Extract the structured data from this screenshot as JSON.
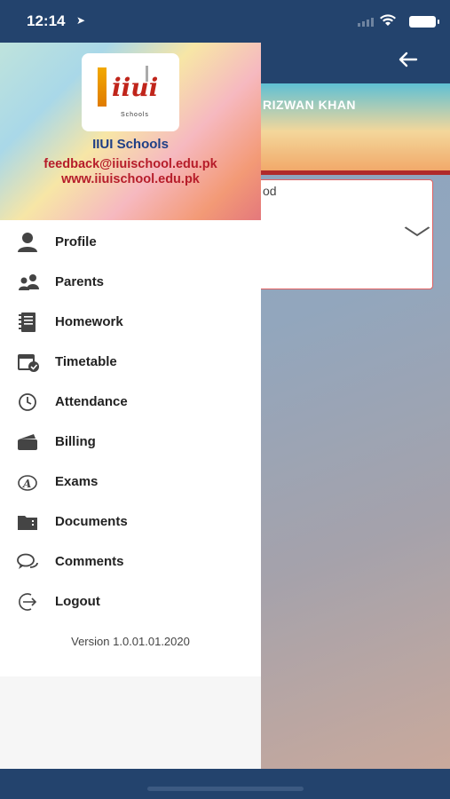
{
  "status_bar": {
    "time": "12:14"
  },
  "app_bar": {
    "back_icon": "arrow-left-icon"
  },
  "background": {
    "student_name": "RIZWAN KHAN",
    "card_text": "od"
  },
  "drawer": {
    "school_name": "IIUI Schools",
    "email": "feedback@iiuischool.edu.pk",
    "website": "www.iiuischool.edu.pk",
    "logo": {
      "text": "iiui",
      "subtitle": "Schools"
    },
    "menu_items": [
      {
        "label": "Profile",
        "icon": "person-icon"
      },
      {
        "label": "Parents",
        "icon": "parents-icon"
      },
      {
        "label": "Homework",
        "icon": "notebook-icon"
      },
      {
        "label": "Timetable",
        "icon": "calendar-check-icon"
      },
      {
        "label": "Attendance",
        "icon": "clock-icon"
      },
      {
        "label": "Billing",
        "icon": "wallet-icon"
      },
      {
        "label": "Exams",
        "icon": "exam-icon"
      },
      {
        "label": "Documents",
        "icon": "folder-icon"
      },
      {
        "label": "Comments",
        "icon": "comments-icon"
      },
      {
        "label": "Logout",
        "icon": "logout-icon"
      }
    ],
    "version": "Version 1.0.01.01.2020"
  }
}
